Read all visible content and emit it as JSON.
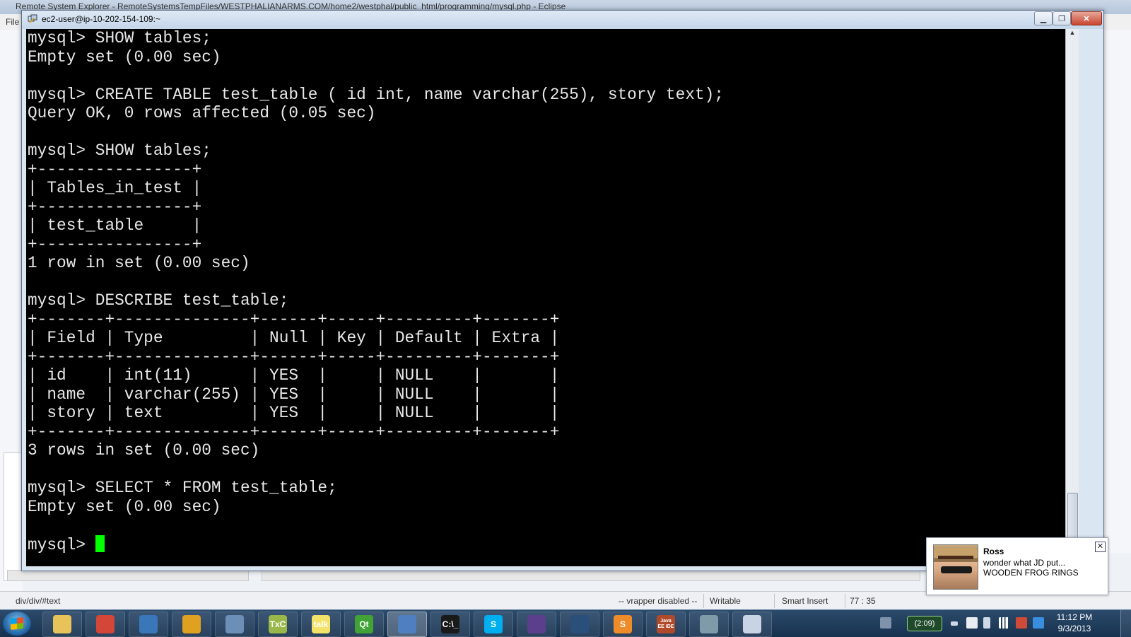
{
  "background_window": {
    "title": "Remote System Explorer - RemoteSystemsTempFiles/WESTPHALIANARMS.COM/home2/westphal/public_html/programming/mysql.php - Eclipse",
    "menu_first": "File",
    "status": {
      "path": "div/div/#text",
      "vrapper": "-- vrapper disabled --",
      "writable": "Writable",
      "insert_mode": "Smart Insert",
      "position": "77 : 35"
    }
  },
  "terminal": {
    "title": "ec2-user@ip-10-202-154-109:~",
    "lines": [
      "mysql> SHOW tables;",
      "Empty set (0.00 sec)",
      "",
      "mysql> CREATE TABLE test_table ( id int, name varchar(255), story text);",
      "Query OK, 0 rows affected (0.05 sec)",
      "",
      "mysql> SHOW tables;",
      "+----------------+",
      "| Tables_in_test |",
      "+----------------+",
      "| test_table     |",
      "+----------------+",
      "1 row in set (0.00 sec)",
      "",
      "mysql> DESCRIBE test_table;",
      "+-------+--------------+------+-----+---------+-------+",
      "| Field | Type         | Null | Key | Default | Extra |",
      "+-------+--------------+------+-----+---------+-------+",
      "| id    | int(11)      | YES  |     | NULL    |       |",
      "| name  | varchar(255) | YES  |     | NULL    |       |",
      "| story | text         | YES  |     | NULL    |       |",
      "+-------+--------------+------+-----+---------+-------+",
      "3 rows in set (0.00 sec)",
      "",
      "mysql> SELECT * FROM test_table;",
      "Empty set (0.00 sec)",
      ""
    ],
    "prompt": "mysql> ",
    "cursor_color": "#00ff00"
  },
  "notification": {
    "name": "Ross",
    "message_line1": "wonder what JD put...",
    "message_line2": "WOODEN FROG RINGS",
    "close_label": "✕"
  },
  "taskbar": {
    "apps": [
      {
        "name": "explorer-icon",
        "label": "",
        "color": "#e8c35a"
      },
      {
        "name": "chrome-icon",
        "label": "",
        "color": "#d44638"
      },
      {
        "name": "thunderbird-icon",
        "label": "",
        "color": "#3a77b9"
      },
      {
        "name": "winamp-icon",
        "label": "",
        "color": "#e0a020"
      },
      {
        "name": "security-icon",
        "label": "",
        "color": "#6c8fb8"
      },
      {
        "name": "txc-icon",
        "label": "TxC",
        "color": "#9ab84a"
      },
      {
        "name": "gtalk-icon",
        "label": "talk",
        "color": "#f2e267"
      },
      {
        "name": "qt-icon",
        "label": "Qt",
        "color": "#41a335"
      },
      {
        "name": "putty-icon",
        "label": "",
        "color": "#4f7fc0"
      },
      {
        "name": "cmd-icon",
        "label": "C:\\_",
        "color": "#1a1a1a"
      },
      {
        "name": "skype-icon",
        "label": "S",
        "color": "#00aff0"
      },
      {
        "name": "eclipse-icon",
        "label": "",
        "color": "#5b3f8c"
      },
      {
        "name": "folder-icon",
        "label": "",
        "color": "#2a4f7a"
      },
      {
        "name": "sublime-icon",
        "label": "S",
        "color": "#ef8c2a"
      },
      {
        "name": "java-ee-ide-icon",
        "label": "Java EE IDE",
        "color": "#b04a2a"
      },
      {
        "name": "files-icon",
        "label": "",
        "color": "#7f9aa8"
      },
      {
        "name": "paint-icon",
        "label": "",
        "color": "#c8d4e4"
      }
    ],
    "tray": {
      "battery_label": "(2:09)",
      "time": "11:12 PM",
      "date": "9/3/2013"
    }
  }
}
